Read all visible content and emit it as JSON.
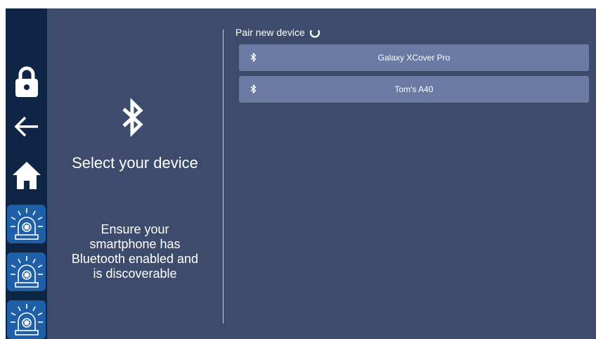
{
  "left_panel": {
    "title": "Select your device",
    "instructions_line1": "Ensure your",
    "instructions_line2": "smartphone has",
    "instructions_line3": "Bluetooth enabled and",
    "instructions_line4": "is discoverable"
  },
  "pair_section": {
    "header": "Pair new device",
    "devices": [
      {
        "name": "Galaxy XCover Pro",
        "icon": "bluetooth-icon"
      },
      {
        "name": "Tom's A40",
        "icon": "bluetooth-icon"
      }
    ]
  },
  "sidebar": {
    "items": [
      {
        "icon": "lock-icon"
      },
      {
        "icon": "back-arrow-icon"
      },
      {
        "icon": "home-icon"
      },
      {
        "icon": "alarm-siren-icon"
      },
      {
        "icon": "alarm-siren-icon"
      },
      {
        "icon": "alarm-siren-icon"
      }
    ]
  },
  "colors": {
    "background": "#3d4b6c",
    "sidebar": "#0f2545",
    "siren_button": "#1e5fa8",
    "device_row": "#6b7aa3"
  }
}
